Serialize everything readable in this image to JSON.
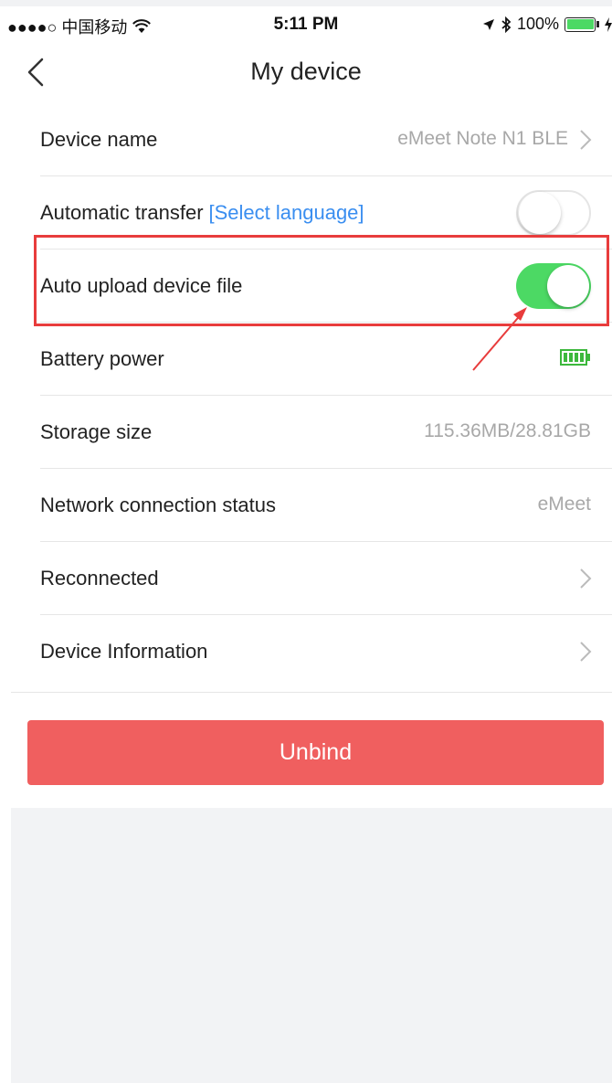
{
  "status_bar": {
    "carrier": "●●●●○ 中国移动",
    "time": "5:11 PM",
    "battery_pct": "100%"
  },
  "nav": {
    "title": "My device"
  },
  "rows": [
    {
      "label": "Device name",
      "value": "eMeet Note N1 BLE",
      "chevron": true
    },
    {
      "label": "Automatic transfer",
      "link": "[Select language]",
      "toggle": false
    },
    {
      "label": "Auto upload device file",
      "toggle": true
    },
    {
      "label": "Battery power",
      "battery_level": 1.0
    },
    {
      "label": "Storage size",
      "value": "115.36MB/28.81GB"
    },
    {
      "label": "Network connection status",
      "value": "eMeet"
    },
    {
      "label": "Reconnected",
      "chevron": true
    },
    {
      "label": "Device Information",
      "chevron": true
    }
  ],
  "unbind_label": "Unbind",
  "colors": {
    "accent_link": "#3a8ef0",
    "toggle_on": "#4cd964",
    "danger_button": "#f05f5f",
    "highlight": "#e83c3c"
  }
}
